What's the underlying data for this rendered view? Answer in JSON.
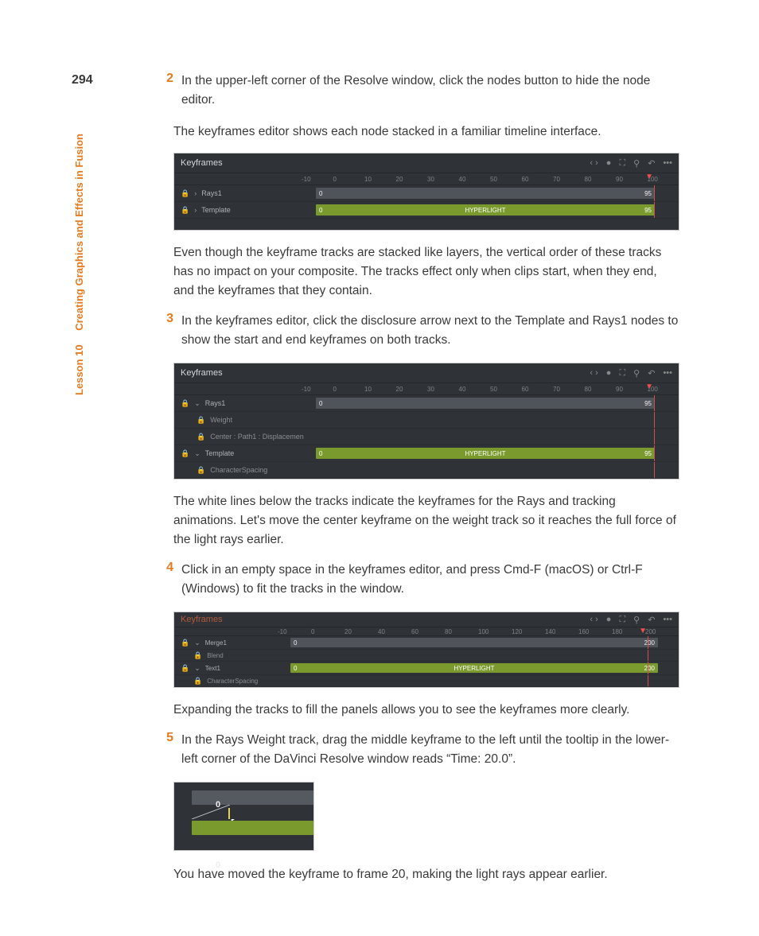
{
  "page_number": "294",
  "sidebar": {
    "lesson": "Lesson 10",
    "title": "Creating Graphics and Effects in Fusion"
  },
  "steps": {
    "s2": {
      "num": "2",
      "text": "In the upper-left corner of the Resolve window, click the nodes button to hide the node editor."
    },
    "s2b": "The keyframes editor shows each node stacked in a familiar timeline interface.",
    "s2c": "Even though the keyframe tracks are stacked like layers, the vertical order of these tracks has no impact on your composite. The tracks effect only when clips start, when they end, and the keyframes that they contain.",
    "s3": {
      "num": "3",
      "text": "In the keyframes editor, click the disclosure arrow next to the Template and Rays1 nodes to show the start and end keyframes on both tracks."
    },
    "s3b": "The white lines below the tracks indicate the keyframes for the Rays and tracking animations. Let's move the center keyframe on the weight track so it reaches the full force of the light rays earlier.",
    "s4": {
      "num": "4",
      "text": "Click in an empty space in the keyframes editor, and press Cmd-F (macOS) or Ctrl-F (Windows) to fit the tracks in the window."
    },
    "s4b": "Expanding the tracks to fill the panels allows you to see the keyframes more clearly.",
    "s5": {
      "num": "5",
      "text": "In the Rays Weight track, drag the middle keyframe to the left until the tooltip in the lower-left corner of the DaVinci Resolve window reads “Time: 20.0”."
    },
    "s5b": "You have moved the keyframe to frame 20, making the light rays appear earlier."
  },
  "shot1": {
    "title": "Keyframes",
    "ruler": [
      "-10",
      "0",
      "10",
      "20",
      "30",
      "40",
      "50",
      "60",
      "70",
      "80",
      "90",
      "100"
    ],
    "tracks": [
      {
        "label": "Rays1",
        "start": "0",
        "end": "95"
      },
      {
        "label": "Template",
        "start": "0",
        "end": "95",
        "center": "HYPERLIGHT"
      }
    ]
  },
  "shot2": {
    "title": "Keyframes",
    "ruler": [
      "-10",
      "0",
      "10",
      "20",
      "30",
      "40",
      "50",
      "60",
      "70",
      "80",
      "90",
      "100"
    ],
    "tracks": {
      "rays": {
        "label": "Rays1",
        "start": "0",
        "end": "95"
      },
      "weight": {
        "label": "Weight"
      },
      "center": {
        "label": "Center : Path1 : Displacemen"
      },
      "template": {
        "label": "Template",
        "start": "0",
        "end": "95",
        "center": "HYPERLIGHT"
      },
      "charspacing": {
        "label": "CharacterSpacing"
      }
    }
  },
  "shot3": {
    "title": "Keyframes",
    "ruler": [
      "-10",
      "0",
      "20",
      "40",
      "60",
      "80",
      "100",
      "120",
      "140",
      "160",
      "180",
      "200"
    ],
    "tracks": {
      "merge": {
        "label": "Merge1",
        "start": "0",
        "end": "200"
      },
      "blend": {
        "label": "Blend"
      },
      "text": {
        "label": "Text1",
        "start": "0",
        "end": "200",
        "center": "HYPERLIGHT"
      },
      "charspacing": {
        "label": "CharacterSpacing"
      }
    }
  },
  "shot4": {
    "zero_top": "0",
    "zero_bottom": "0"
  },
  "icons": {
    "arrows": "‹ ›",
    "dot": "●",
    "expand": "⛶",
    "search": "⚲",
    "undo": "↶",
    "more": "•••",
    "lock": "🔒",
    "right": "›",
    "down": "⌄",
    "playhead": "▼",
    "cursor": "↖"
  }
}
